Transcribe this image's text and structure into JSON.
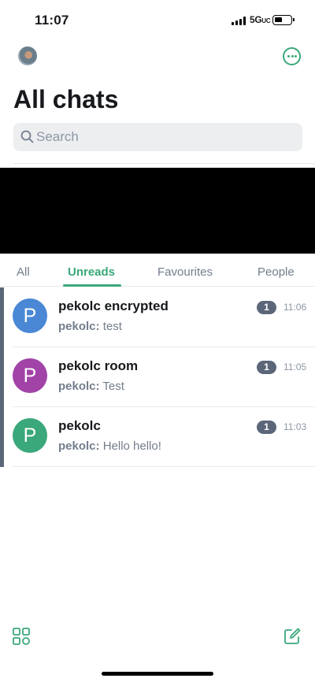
{
  "status_bar": {
    "time": "11:07",
    "network": "5G",
    "network_suffix": "UC"
  },
  "header": {
    "title": "All chats",
    "avatar_icon": "user-avatar",
    "menu_icon": "more-horizontal-circle-icon"
  },
  "search": {
    "placeholder": "Search"
  },
  "tabs": [
    {
      "label": "All",
      "active": false
    },
    {
      "label": "Unreads",
      "active": true
    },
    {
      "label": "Favourites",
      "active": false
    },
    {
      "label": "People",
      "active": false
    }
  ],
  "chats": [
    {
      "initial": "P",
      "name": "pekolc encrypted",
      "sender": "pekolc:",
      "message": "test",
      "unread": "1",
      "time": "11:06",
      "color": "#4a88d5"
    },
    {
      "initial": "P",
      "name": "pekolc room",
      "sender": "pekolc:",
      "message": "Test",
      "unread": "1",
      "time": "11:05",
      "color": "#a243a8"
    },
    {
      "initial": "P",
      "name": "pekolc",
      "sender": "pekolc:",
      "message": "Hello hello!",
      "unread": "1",
      "time": "11:03",
      "color": "#3aa87a"
    }
  ],
  "colors": {
    "accent": "#3aa87a",
    "badge": "#5c6679"
  },
  "bottom_bar": {
    "left_icon": "spaces-grid-icon",
    "right_icon": "compose-icon"
  }
}
